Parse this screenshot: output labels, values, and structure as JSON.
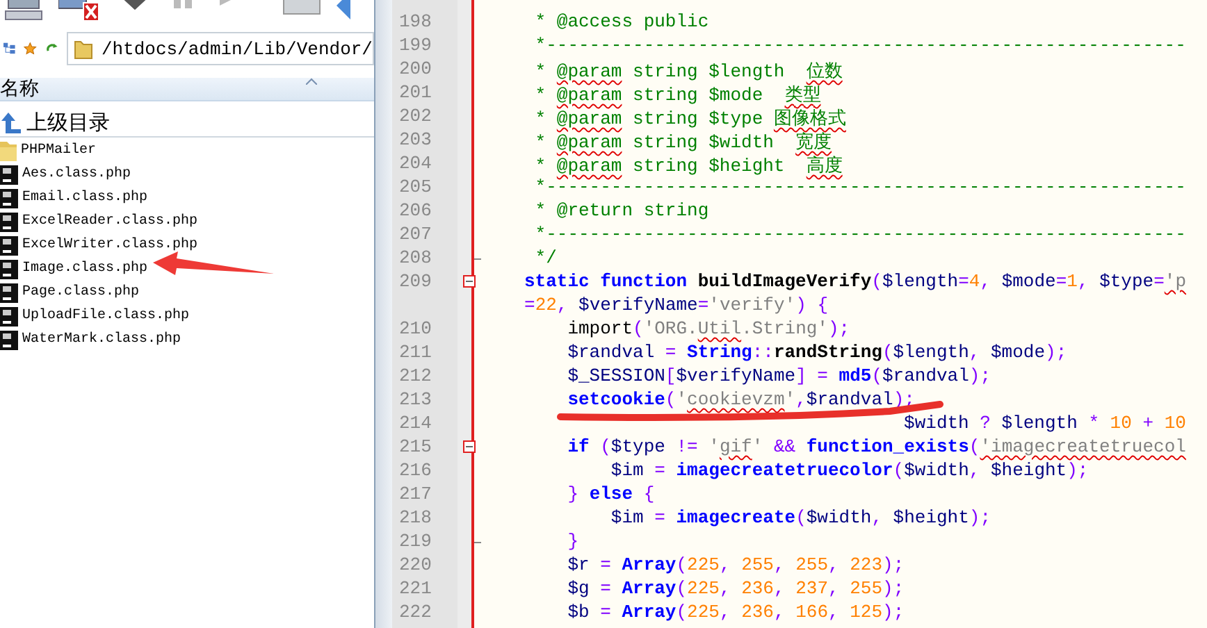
{
  "file_browser": {
    "path": "/htdocs/admin/Lib/Vendor/",
    "column_header": "名称",
    "items": [
      {
        "name": "上级目录",
        "kind": "parent"
      },
      {
        "name": "PHPMailer",
        "kind": "folder"
      },
      {
        "name": "Aes.class.php",
        "kind": "php"
      },
      {
        "name": "Email.class.php",
        "kind": "php"
      },
      {
        "name": "ExcelReader.class.php",
        "kind": "php"
      },
      {
        "name": "ExcelWriter.class.php",
        "kind": "php"
      },
      {
        "name": "Image.class.php",
        "kind": "php"
      },
      {
        "name": "Page.class.php",
        "kind": "php"
      },
      {
        "name": "UploadFile.class.php",
        "kind": "php"
      },
      {
        "name": "WaterMark.class.php",
        "kind": "php"
      }
    ]
  },
  "editor": {
    "lines": [
      {
        "number": "198",
        "fold_start": false,
        "fold_end": false,
        "tokens": [
          {
            "kind": "comment",
            "text": " * @access public"
          }
        ]
      },
      {
        "number": "199",
        "fold_start": false,
        "fold_end": false,
        "tokens": [
          {
            "kind": "comment",
            "text": " *-----------------------------------------------------------"
          }
        ]
      },
      {
        "number": "200",
        "fold_start": false,
        "fold_end": false,
        "tokens": [
          {
            "kind": "comment",
            "text": " * "
          },
          {
            "kind": "comment",
            "text": "@param",
            "misspelled": true
          },
          {
            "kind": "comment",
            "text": " string $length  "
          },
          {
            "kind": "comment",
            "text": "位数",
            "misspelled": true
          }
        ]
      },
      {
        "number": "201",
        "fold_start": false,
        "fold_end": false,
        "tokens": [
          {
            "kind": "comment",
            "text": " * "
          },
          {
            "kind": "comment",
            "text": "@param",
            "misspelled": true
          },
          {
            "kind": "comment",
            "text": " string $mode  "
          },
          {
            "kind": "comment",
            "text": "类型",
            "misspelled": true
          }
        ]
      },
      {
        "number": "202",
        "fold_start": false,
        "fold_end": false,
        "tokens": [
          {
            "kind": "comment",
            "text": " * "
          },
          {
            "kind": "comment",
            "text": "@param",
            "misspelled": true
          },
          {
            "kind": "comment",
            "text": " string $type "
          },
          {
            "kind": "comment",
            "text": "图像格式",
            "misspelled": true
          }
        ]
      },
      {
        "number": "203",
        "fold_start": false,
        "fold_end": false,
        "tokens": [
          {
            "kind": "comment",
            "text": " * "
          },
          {
            "kind": "comment",
            "text": "@param",
            "misspelled": true
          },
          {
            "kind": "comment",
            "text": " string $width  "
          },
          {
            "kind": "comment",
            "text": "宽度",
            "misspelled": true
          }
        ]
      },
      {
        "number": "204",
        "fold_start": false,
        "fold_end": false,
        "tokens": [
          {
            "kind": "comment",
            "text": " * "
          },
          {
            "kind": "comment",
            "text": "@param",
            "misspelled": true
          },
          {
            "kind": "comment",
            "text": " string $height  "
          },
          {
            "kind": "comment",
            "text": "高度",
            "misspelled": true
          }
        ]
      },
      {
        "number": "205",
        "fold_start": false,
        "fold_end": false,
        "tokens": [
          {
            "kind": "comment",
            "text": " *-----------------------------------------------------------"
          }
        ]
      },
      {
        "number": "206",
        "fold_start": false,
        "fold_end": false,
        "tokens": [
          {
            "kind": "comment",
            "text": " * @return string"
          }
        ]
      },
      {
        "number": "207",
        "fold_start": false,
        "fold_end": false,
        "tokens": [
          {
            "kind": "comment",
            "text": " *-----------------------------------------------------------"
          }
        ]
      },
      {
        "number": "208",
        "fold_start": false,
        "fold_end": true,
        "tokens": [
          {
            "kind": "comment",
            "text": " */"
          }
        ]
      },
      {
        "number": "209",
        "fold_start": true,
        "fold_end": false,
        "tokens": [
          {
            "kind": "keyword",
            "text": "static"
          },
          {
            "kind": "keyword",
            "text": " function"
          },
          {
            "kind": "func",
            "text": " buildImageVerify"
          },
          {
            "kind": "op",
            "text": "("
          },
          {
            "kind": "var",
            "text": "$length"
          },
          {
            "kind": "op",
            "text": "="
          },
          {
            "kind": "num",
            "text": "4"
          },
          {
            "kind": "op",
            "text": ","
          },
          {
            "kind": "var",
            "text": " $mode"
          },
          {
            "kind": "op",
            "text": "="
          },
          {
            "kind": "num",
            "text": "1"
          },
          {
            "kind": "op",
            "text": ","
          },
          {
            "kind": "var",
            "text": " $type"
          },
          {
            "kind": "op",
            "text": "="
          },
          {
            "kind": "str",
            "text": "'p",
            "misspelled": true
          }
        ],
        "continuation": [
          {
            "kind": "op",
            "text": "="
          },
          {
            "kind": "num",
            "text": "22"
          },
          {
            "kind": "op",
            "text": ","
          },
          {
            "kind": "var",
            "text": " $verifyName"
          },
          {
            "kind": "op",
            "text": "="
          },
          {
            "kind": "str",
            "text": "'verify'"
          },
          {
            "kind": "op",
            "text": ")"
          },
          {
            "kind": "op",
            "text": " {"
          }
        ]
      },
      {
        "number": "210",
        "fold_start": false,
        "fold_end": false,
        "tokens": [
          {
            "kind": "plain",
            "text": "    import"
          },
          {
            "kind": "op",
            "text": "("
          },
          {
            "kind": "str",
            "text": "'ORG."
          },
          {
            "kind": "str",
            "text": "Util",
            "misspelled": true
          },
          {
            "kind": "str",
            "text": ".String'"
          },
          {
            "kind": "op",
            "text": ");"
          }
        ]
      },
      {
        "number": "211",
        "fold_start": false,
        "fold_end": false,
        "tokens": [
          {
            "kind": "var",
            "text": "    $randval"
          },
          {
            "kind": "op",
            "text": " ="
          },
          {
            "kind": "keyword",
            "text": " String"
          },
          {
            "kind": "op",
            "text": "::"
          },
          {
            "kind": "func",
            "text": "randString"
          },
          {
            "kind": "op",
            "text": "("
          },
          {
            "kind": "var",
            "text": "$length"
          },
          {
            "kind": "op",
            "text": ","
          },
          {
            "kind": "var",
            "text": " $mode"
          },
          {
            "kind": "op",
            "text": ");"
          }
        ]
      },
      {
        "number": "212",
        "fold_start": false,
        "fold_end": false,
        "tokens": [
          {
            "kind": "var",
            "text": "    $_SESSION"
          },
          {
            "kind": "op",
            "text": "["
          },
          {
            "kind": "var",
            "text": "$verifyName"
          },
          {
            "kind": "op",
            "text": "] ="
          },
          {
            "kind": "keyword",
            "text": " md5"
          },
          {
            "kind": "op",
            "text": "("
          },
          {
            "kind": "var",
            "text": "$randval"
          },
          {
            "kind": "op",
            "text": ");"
          }
        ]
      },
      {
        "number": "213",
        "fold_start": false,
        "fold_end": false,
        "tokens": [
          {
            "kind": "keyword",
            "text": "    setcookie"
          },
          {
            "kind": "op",
            "text": "("
          },
          {
            "kind": "str",
            "text": "'"
          },
          {
            "kind": "str",
            "text": "cookievzm",
            "misspelled": true
          },
          {
            "kind": "str",
            "text": "'"
          },
          {
            "kind": "op",
            "text": ","
          },
          {
            "kind": "var",
            "text": "$randval"
          },
          {
            "kind": "op",
            "text": ");"
          }
        ]
      },
      {
        "number": "214",
        "fold_start": false,
        "fold_end": false,
        "tokens": [
          {
            "kind": "var",
            "text": "                                   $width"
          },
          {
            "kind": "op",
            "text": " ?"
          },
          {
            "kind": "var",
            "text": " $length"
          },
          {
            "kind": "op",
            "text": " *"
          },
          {
            "kind": "num",
            "text": " 10"
          },
          {
            "kind": "op",
            "text": " +"
          },
          {
            "kind": "num",
            "text": " 10"
          }
        ]
      },
      {
        "number": "215",
        "fold_start": true,
        "fold_end": false,
        "tokens": [
          {
            "kind": "keyword",
            "text": "    if"
          },
          {
            "kind": "op",
            "text": " ("
          },
          {
            "kind": "var",
            "text": "$type"
          },
          {
            "kind": "op",
            "text": " !="
          },
          {
            "kind": "str",
            "text": " '"
          },
          {
            "kind": "str",
            "text": "gif",
            "misspelled": true
          },
          {
            "kind": "str",
            "text": "'"
          },
          {
            "kind": "op",
            "text": " &&"
          },
          {
            "kind": "keyword",
            "text": " function_exists"
          },
          {
            "kind": "op",
            "text": "("
          },
          {
            "kind": "str",
            "text": "'imagecreatetruecol",
            "misspelled": true
          }
        ]
      },
      {
        "number": "216",
        "fold_start": false,
        "fold_end": false,
        "tokens": [
          {
            "kind": "var",
            "text": "        $im"
          },
          {
            "kind": "op",
            "text": " ="
          },
          {
            "kind": "keyword",
            "text": " imagecreatetruecolor"
          },
          {
            "kind": "op",
            "text": "("
          },
          {
            "kind": "var",
            "text": "$width"
          },
          {
            "kind": "op",
            "text": ","
          },
          {
            "kind": "var",
            "text": " $height"
          },
          {
            "kind": "op",
            "text": ");"
          }
        ]
      },
      {
        "number": "217",
        "fold_start": false,
        "fold_end": false,
        "tokens": [
          {
            "kind": "op",
            "text": "    }"
          },
          {
            "kind": "keyword",
            "text": " else"
          },
          {
            "kind": "op",
            "text": " {"
          }
        ]
      },
      {
        "number": "218",
        "fold_start": false,
        "fold_end": false,
        "tokens": [
          {
            "kind": "var",
            "text": "        $im"
          },
          {
            "kind": "op",
            "text": " ="
          },
          {
            "kind": "keyword",
            "text": " imagecreate"
          },
          {
            "kind": "op",
            "text": "("
          },
          {
            "kind": "var",
            "text": "$width"
          },
          {
            "kind": "op",
            "text": ","
          },
          {
            "kind": "var",
            "text": " $height"
          },
          {
            "kind": "op",
            "text": ");"
          }
        ]
      },
      {
        "number": "219",
        "fold_start": false,
        "fold_end": true,
        "tokens": [
          {
            "kind": "op",
            "text": "    }"
          }
        ]
      },
      {
        "number": "220",
        "fold_start": false,
        "fold_end": false,
        "tokens": [
          {
            "kind": "var",
            "text": "    $r"
          },
          {
            "kind": "op",
            "text": " ="
          },
          {
            "kind": "keyword",
            "text": " Array"
          },
          {
            "kind": "op",
            "text": "("
          },
          {
            "kind": "num",
            "text": "225"
          },
          {
            "kind": "op",
            "text": ","
          },
          {
            "kind": "num",
            "text": " 255"
          },
          {
            "kind": "op",
            "text": ","
          },
          {
            "kind": "num",
            "text": " 255"
          },
          {
            "kind": "op",
            "text": ","
          },
          {
            "kind": "num",
            "text": " 223"
          },
          {
            "kind": "op",
            "text": ");"
          }
        ]
      },
      {
        "number": "221",
        "fold_start": false,
        "fold_end": false,
        "tokens": [
          {
            "kind": "var",
            "text": "    $g"
          },
          {
            "kind": "op",
            "text": " ="
          },
          {
            "kind": "keyword",
            "text": " Array"
          },
          {
            "kind": "op",
            "text": "("
          },
          {
            "kind": "num",
            "text": "225"
          },
          {
            "kind": "op",
            "text": ","
          },
          {
            "kind": "num",
            "text": " 236"
          },
          {
            "kind": "op",
            "text": ","
          },
          {
            "kind": "num",
            "text": " 237"
          },
          {
            "kind": "op",
            "text": ","
          },
          {
            "kind": "num",
            "text": " 255"
          },
          {
            "kind": "op",
            "text": ");"
          }
        ]
      },
      {
        "number": "222",
        "fold_start": false,
        "fold_end": false,
        "tokens": [
          {
            "kind": "var",
            "text": "    $b"
          },
          {
            "kind": "op",
            "text": " ="
          },
          {
            "kind": "keyword",
            "text": " Array"
          },
          {
            "kind": "op",
            "text": "("
          },
          {
            "kind": "num",
            "text": "225"
          },
          {
            "kind": "op",
            "text": ","
          },
          {
            "kind": "num",
            "text": " 236"
          },
          {
            "kind": "op",
            "text": ","
          },
          {
            "kind": "num",
            "text": " 166"
          },
          {
            "kind": "op",
            "text": ","
          },
          {
            "kind": "num",
            "text": " 125"
          },
          {
            "kind": "op",
            "text": ");"
          }
        ]
      }
    ]
  },
  "annotations": {
    "arrow": true,
    "underline": true
  }
}
